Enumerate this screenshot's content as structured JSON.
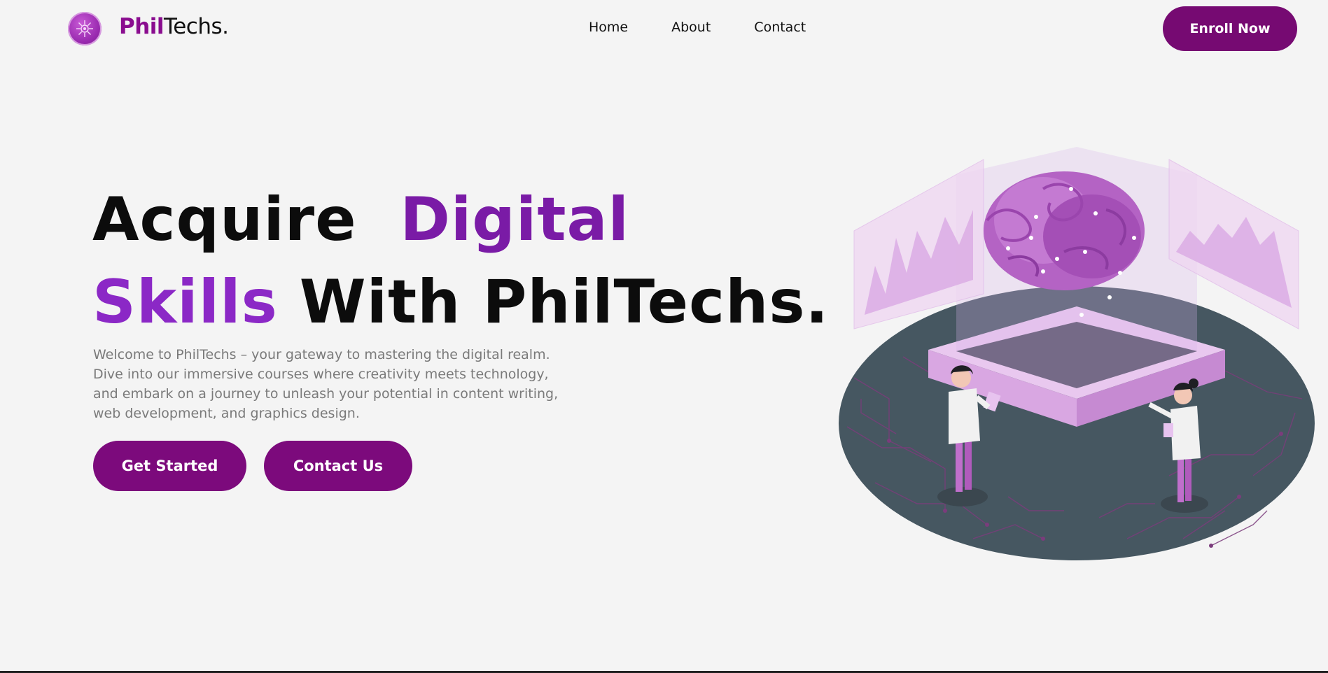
{
  "brand": {
    "name_part1": "Phil",
    "name_part2": "Techs.",
    "logo_icon": "gear-snowflake-icon",
    "accent_color": "#760a72"
  },
  "nav": {
    "links": [
      {
        "label": "Home"
      },
      {
        "label": "About"
      },
      {
        "label": "Contact"
      }
    ],
    "cta_label": "Enroll Now"
  },
  "hero": {
    "title_word1": "Acquire",
    "title_word2": "Digital",
    "title_word3": "Skills",
    "title_rest": "With PhilTechs.",
    "description": "Welcome to PhilTechs – your gateway to mastering the digital realm. Dive into our immersive courses where creativity meets technology, and embark on a journey to unleash your potential in content writing, web development, and graphics design.",
    "primary_button": "Get Started",
    "secondary_button": "Contact Us"
  },
  "illustration": {
    "icon": "isometric-brain-platform-illustration"
  }
}
